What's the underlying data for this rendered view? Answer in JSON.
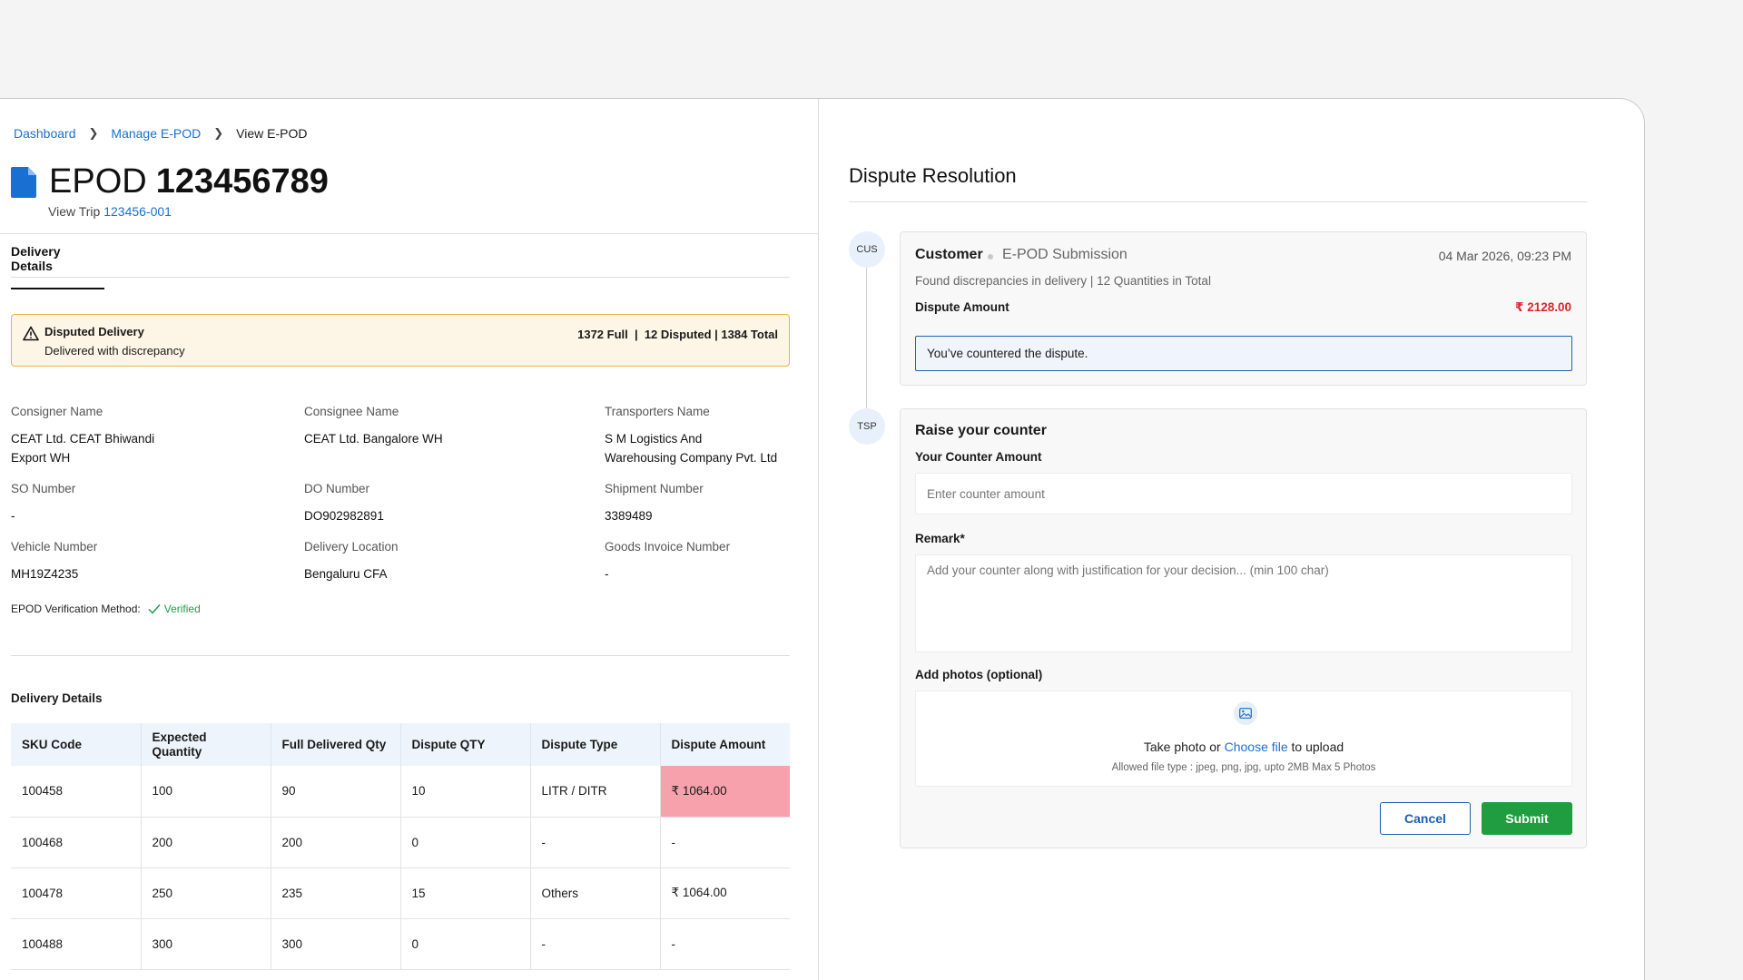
{
  "breadcrumb": {
    "items": [
      "Dashboard",
      "Manage E-POD"
    ],
    "current": "View E-POD"
  },
  "header": {
    "title_prefix": "EPOD",
    "title_number": "123456789",
    "view_trip_label": "View Trip",
    "trip_id": "123456-001"
  },
  "tab": {
    "label": "Delivery Details"
  },
  "alert": {
    "title": "Disputed Delivery",
    "subtitle": "Delivered with discrepancy",
    "summary": "1372 Full  |  12 Disputed | 1384 Total"
  },
  "fields": {
    "consigner_name": {
      "label": "Consigner Name",
      "value_line1": "CEAT Ltd. CEAT Bhiwandi",
      "value_line2": "Export WH"
    },
    "consignee_name": {
      "label": "Consignee Name",
      "value": "CEAT Ltd. Bangalore WH"
    },
    "transporters_name": {
      "label": "Transporters Name",
      "value_line1": "S M Logistics And",
      "value_line2": "Warehousing Company Pvt. Ltd"
    },
    "so_number": {
      "label": "SO Number",
      "value": "-"
    },
    "do_number": {
      "label": "DO Number",
      "value": "DO902982891"
    },
    "shipment_number": {
      "label": "Shipment Number",
      "value": "3389489"
    },
    "vehicle_number": {
      "label": "Vehicle Number",
      "value": "MH19Z4235"
    },
    "delivery_location": {
      "label": "Delivery Location",
      "value": "Bengaluru CFA"
    },
    "goods_invoice_number": {
      "label": "Goods Invoice Number",
      "value": "-"
    }
  },
  "verification": {
    "label": "EPOD Verification Method:",
    "status": "Verified"
  },
  "table": {
    "title": "Delivery Details",
    "headers": [
      "SKU Code",
      "Expected Quantity",
      "Full Delivered Qty",
      "Dispute QTY",
      "Dispute Type",
      "Dispute Amount"
    ],
    "rows": [
      [
        "100458",
        "100",
        "90",
        "10",
        "LITR / DITR",
        "₹ 1064.00"
      ],
      [
        "100468",
        "200",
        "200",
        "0",
        "-",
        "-"
      ],
      [
        "100478",
        "250",
        "235",
        "15",
        "Others",
        "₹ 1064.00"
      ],
      [
        "100488",
        "300",
        "300",
        "0",
        "-",
        "-"
      ]
    ],
    "highlight_color": "#f7a1ac"
  },
  "dispute": {
    "title": "Dispute Resolution",
    "entry": {
      "avatar": "CUS",
      "party": "Customer",
      "kind": "E-POD Submission",
      "date": "04 Mar 2026, 09:23 PM",
      "description": "Found discrepancies in delivery | 12 Quantities in Total",
      "amount_label": "Dispute Amount",
      "amount": "₹ 2128.00",
      "note": "You’ve countered the dispute."
    },
    "counter": {
      "avatar": "TSP",
      "title": "Raise your counter",
      "amount_label": "Your Counter Amount",
      "amount_value": "",
      "amount_placeholder": "Enter counter amount",
      "remark_label": "Remark*",
      "remark_value": "",
      "remark_placeholder": "Add your counter along with justification for your decision... (min 100 char)",
      "photos_label": "Add photos (optional)",
      "upload_prefix": "Take photo or",
      "upload_link": "Choose file",
      "upload_suffix": "to upload",
      "upload_hint": "Allowed file type : jpeg, png, jpg, upto 2MB Max 5 Photos",
      "cancel_label": "Cancel",
      "submit_label": "Submit"
    }
  },
  "colors": {
    "accent_blue": "#1a6fd3",
    "danger_red": "#d9262d",
    "success_green": "#1f9d3f",
    "warning_border": "#e7b54a"
  }
}
